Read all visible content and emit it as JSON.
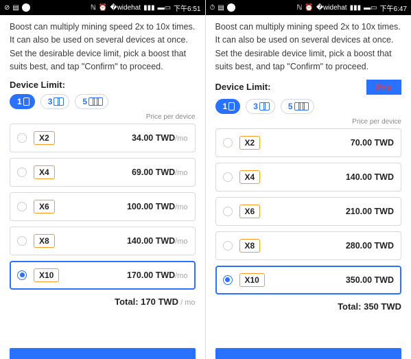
{
  "left": {
    "statusbar": {
      "time": "下午6:51"
    },
    "description": "Boost can multiply mining speed 2x to 10x times. It can also be used on several devices at once. Set the desirable device limit, pick a boost that suits best, and tap \"Confirm\" to proceed.",
    "deviceLimitLabel": "Device Limit:",
    "pills": [
      {
        "count": "1",
        "active": true
      },
      {
        "count": "3",
        "active": false
      },
      {
        "count": "5",
        "active": false
      }
    ],
    "pricePerDevice": "Price per device",
    "options": [
      {
        "mult": "X2",
        "price": "34.00 TWD",
        "suffix": "/mo",
        "selected": false
      },
      {
        "mult": "X4",
        "price": "69.00 TWD",
        "suffix": "/mo",
        "selected": false
      },
      {
        "mult": "X6",
        "price": "100.00 TWD",
        "suffix": "/mo",
        "selected": false
      },
      {
        "mult": "X8",
        "price": "140.00 TWD",
        "suffix": "/mo",
        "selected": false
      },
      {
        "mult": "X10",
        "price": "170.00 TWD",
        "suffix": "/mo",
        "selected": true
      }
    ],
    "totalLabel": "Total: 170 TWD",
    "totalSuffix": " / mo"
  },
  "right": {
    "statusbar": {
      "time": "下午6:47"
    },
    "description": "Boost can multiply mining speed 2x to 10x times. It can also be used on several devices at once. Set the desirable device limit, pick a boost that suits best, and tap \"Confirm\" to proceed.",
    "deviceLimitLabel": "Device Limit:",
    "proLabel": "Pro",
    "pills": [
      {
        "count": "1",
        "active": true
      },
      {
        "count": "3",
        "active": false
      },
      {
        "count": "5",
        "active": false
      }
    ],
    "pricePerDevice": "Price per device",
    "options": [
      {
        "mult": "X2",
        "price": "70.00 TWD",
        "suffix": "",
        "selected": false
      },
      {
        "mult": "X4",
        "price": "140.00 TWD",
        "suffix": "",
        "selected": false
      },
      {
        "mult": "X6",
        "price": "210.00 TWD",
        "suffix": "",
        "selected": false
      },
      {
        "mult": "X8",
        "price": "280.00 TWD",
        "suffix": "",
        "selected": false
      },
      {
        "mult": "X10",
        "price": "350.00 TWD",
        "suffix": "",
        "selected": true
      }
    ],
    "totalLabel": "Total: 350 TWD",
    "totalSuffix": ""
  }
}
